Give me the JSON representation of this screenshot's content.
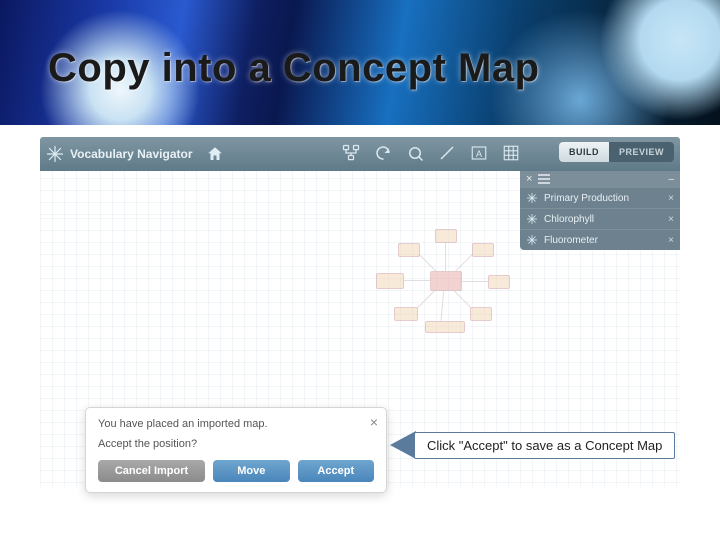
{
  "slide": {
    "title": "Copy into a Concept Map"
  },
  "toolbar": {
    "brand": "Vocabulary Navigator",
    "mode_build": "BUILD",
    "mode_preview": "PREVIEW"
  },
  "side_panel": {
    "items": [
      {
        "label": "Primary Production"
      },
      {
        "label": "Chlorophyll"
      },
      {
        "label": "Fluorometer"
      }
    ]
  },
  "dialog": {
    "line1": "You have placed an imported map.",
    "line2": "Accept the position?",
    "cancel": "Cancel Import",
    "move": "Move",
    "accept": "Accept"
  },
  "callout": {
    "text": "Click \"Accept\" to save as a Concept Map"
  }
}
